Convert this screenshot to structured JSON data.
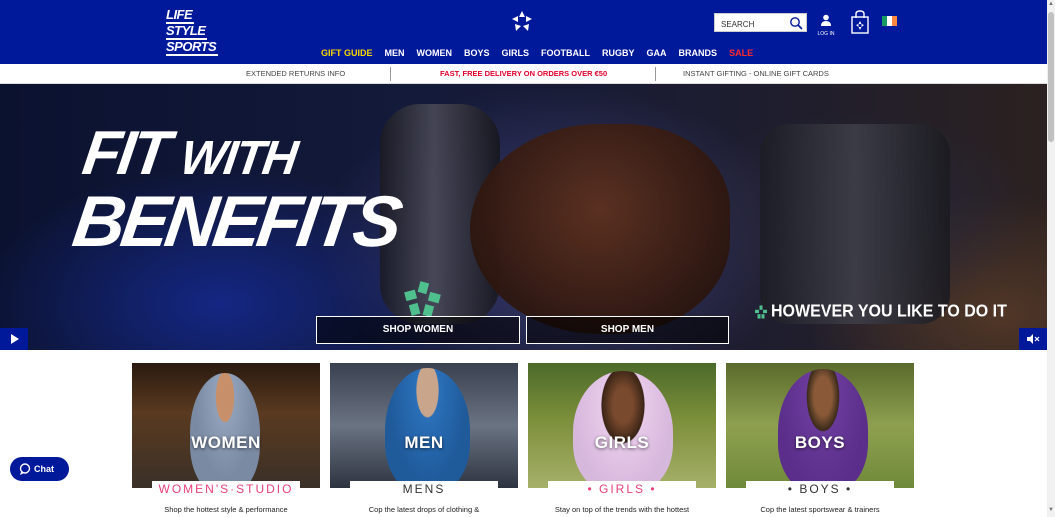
{
  "header": {
    "logo_lines": [
      "LIFE",
      "STYLE",
      "SPORTS"
    ],
    "search_placeholder": "SEARCH",
    "login_label": "LOG IN",
    "nav": [
      {
        "label": "GIFT GUIDE",
        "color": "#f5d800"
      },
      {
        "label": "MEN",
        "color": "#ffffff"
      },
      {
        "label": "WOMEN",
        "color": "#ffffff"
      },
      {
        "label": "BOYS",
        "color": "#ffffff"
      },
      {
        "label": "GIRLS",
        "color": "#ffffff"
      },
      {
        "label": "FOOTBALL",
        "color": "#ffffff"
      },
      {
        "label": "RUGBY",
        "color": "#ffffff"
      },
      {
        "label": "GAA",
        "color": "#ffffff"
      },
      {
        "label": "BRANDS",
        "color": "#ffffff"
      },
      {
        "label": "SALE",
        "color": "#ff2b2b"
      }
    ],
    "brand_color": "#00189a",
    "flag_colors": [
      "#169b62",
      "#ffffff",
      "#ff883e"
    ]
  },
  "infobar": {
    "left": "EXTENDED RETURNS INFO",
    "center": "FAST, FREE DELIVERY ON ORDERS OVER €50",
    "right": "INSTANT GIFTING - ONLINE GIFT CARDS"
  },
  "hero": {
    "title_word1": "FIT",
    "title_word2": "WITH",
    "title_word3": "BENEFITS",
    "tagline": "HOWEVER YOU LIKE TO DO IT",
    "shop_women": "SHOP WOMEN",
    "shop_men": "SHOP MEN",
    "accent_color": "#4fc08d"
  },
  "cards": [
    {
      "title": "WOMEN",
      "label": "WOMEN'S·STUDIO",
      "label_color": "#e8407a",
      "desc": "Shop the hottest style & performance"
    },
    {
      "title": "MEN",
      "label": "MENS",
      "label_color": "#333333",
      "desc": "Cop the latest drops of clothing &"
    },
    {
      "title": "GIRLS",
      "label": "• GIRLS •",
      "label_color": "#e8407a",
      "desc": "Stay on top of the trends with the hottest"
    },
    {
      "title": "BOYS",
      "label": "• BOYS •",
      "label_color": "#333333",
      "desc": "Cop the latest sportswear & trainers"
    }
  ],
  "chat": {
    "label": "Chat"
  }
}
